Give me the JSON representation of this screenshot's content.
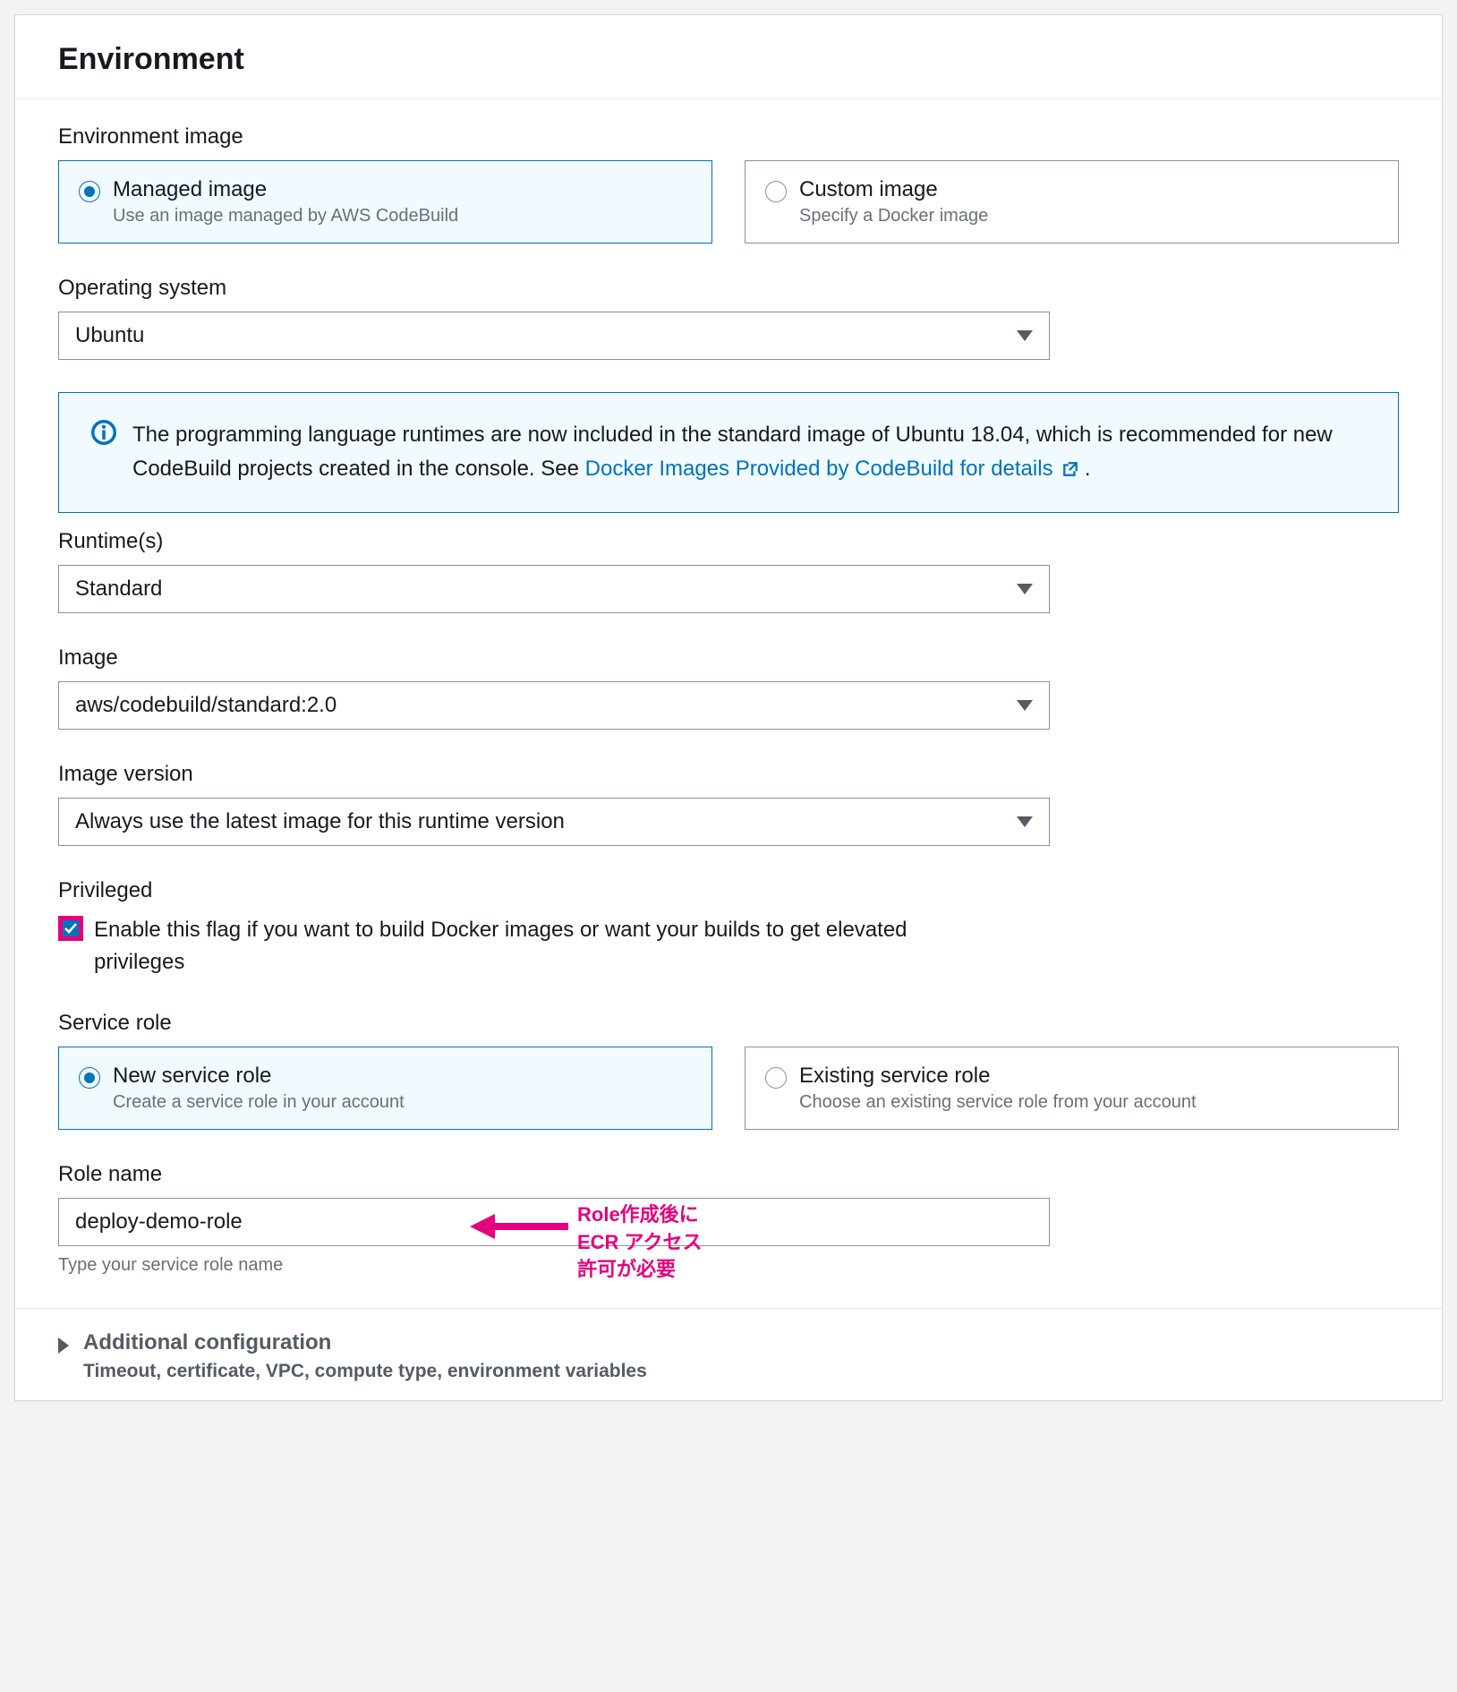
{
  "panel": {
    "title": "Environment"
  },
  "envImage": {
    "label": "Environment image",
    "options": [
      {
        "title": "Managed image",
        "sub": "Use an image managed by AWS CodeBuild"
      },
      {
        "title": "Custom image",
        "sub": "Specify a Docker image"
      }
    ]
  },
  "os": {
    "label": "Operating system",
    "value": "Ubuntu"
  },
  "info": {
    "text": "The programming language runtimes are now included in the standard image of Ubuntu 18.04, which is recommended for new CodeBuild projects created in the console. See ",
    "link": "Docker Images Provided by CodeBuild for details",
    "tail": "."
  },
  "runtime": {
    "label": "Runtime(s)",
    "value": "Standard"
  },
  "image": {
    "label": "Image",
    "value": "aws/codebuild/standard:2.0"
  },
  "imageVersion": {
    "label": "Image version",
    "value": "Always use the latest image for this runtime version"
  },
  "privileged": {
    "label": "Privileged",
    "text": "Enable this flag if you want to build Docker images or want your builds to get elevated privileges"
  },
  "serviceRole": {
    "label": "Service role",
    "options": [
      {
        "title": "New service role",
        "sub": "Create a service role in your account"
      },
      {
        "title": "Existing service role",
        "sub": "Choose an existing service role from your account"
      }
    ]
  },
  "roleName": {
    "label": "Role name",
    "value": "deploy-demo-role",
    "hint": "Type your service role name"
  },
  "annotation": {
    "line1": "Role作成後に",
    "line2": "ECR アクセス",
    "line3": "許可が必要"
  },
  "additional": {
    "title": "Additional configuration",
    "sub": "Timeout, certificate, VPC, compute type, environment variables"
  }
}
